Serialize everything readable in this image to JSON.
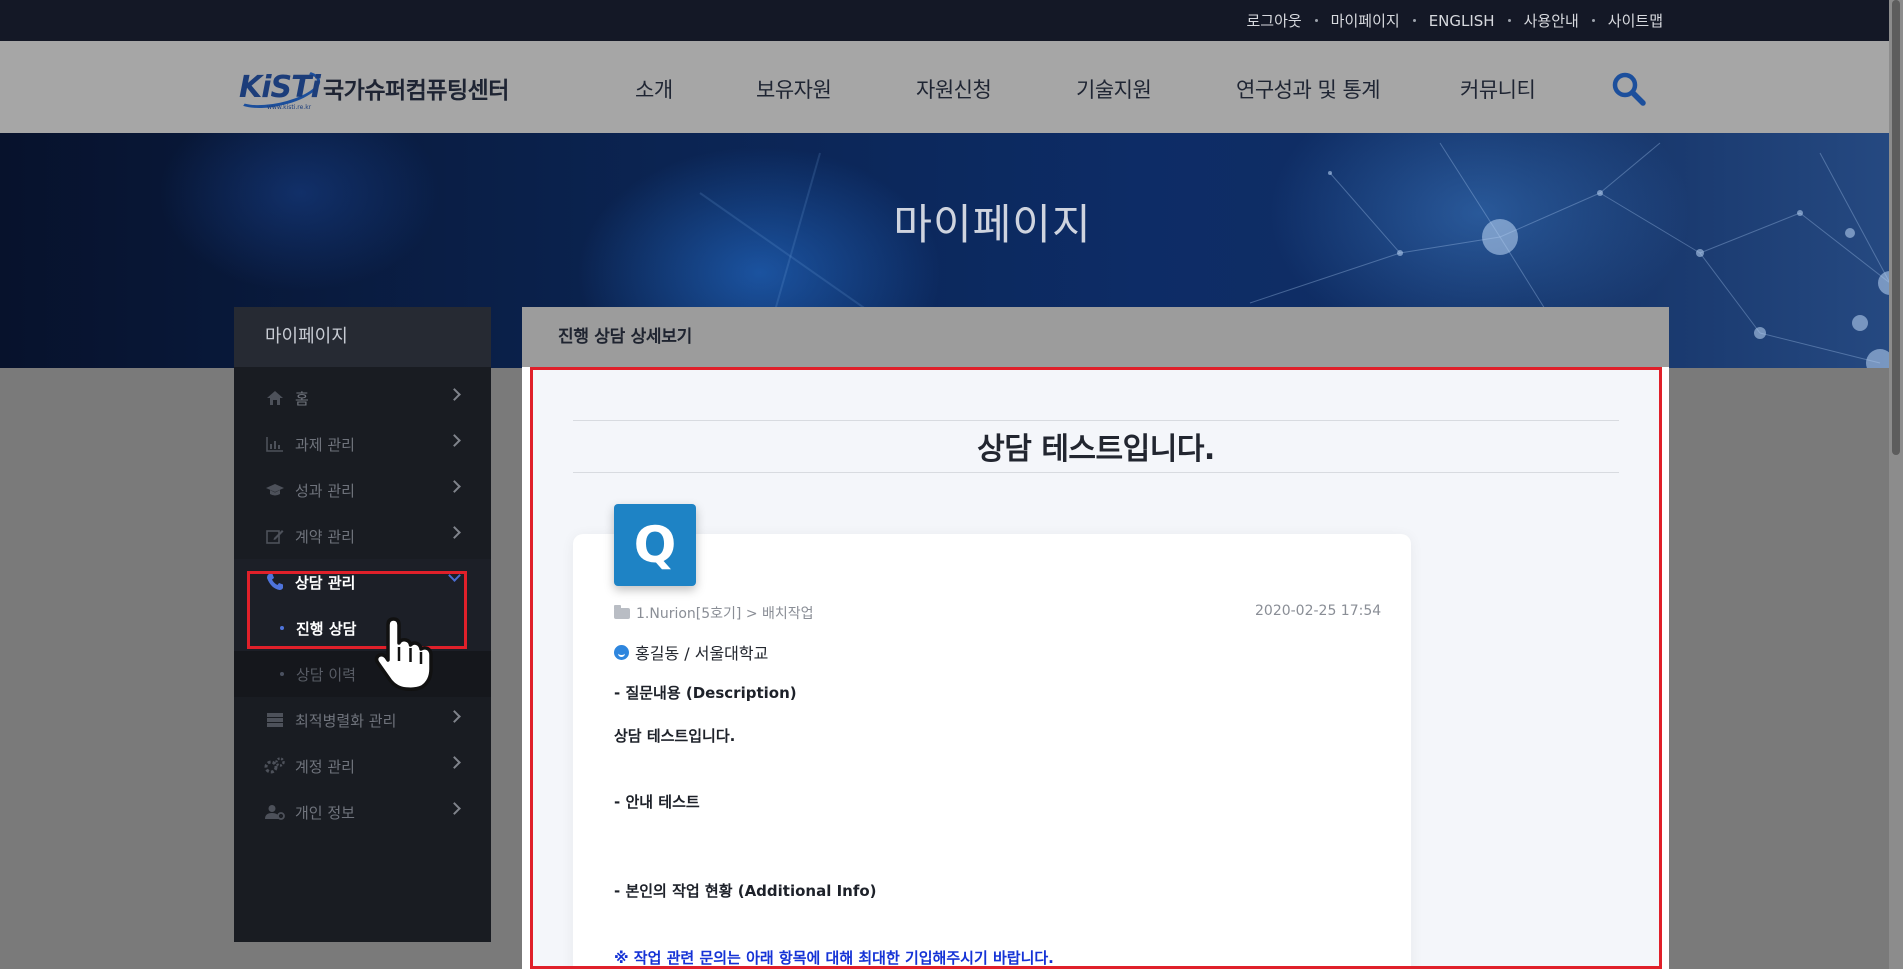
{
  "utility_nav": {
    "logout": "로그아웃",
    "mypage": "마이페이지",
    "english": "ENGLISH",
    "guide": "사용안내",
    "sitemap": "사이트맵"
  },
  "header": {
    "logo_mark": "KiSTi",
    "logo_url": "www.kisti.re.kr",
    "logo_name": "국가슈퍼컴퓨팅센터",
    "menu": [
      "소개",
      "보유자원",
      "자원신청",
      "기술지원",
      "연구성과 및 통계",
      "커뮤니티"
    ],
    "search_icon": "search-icon"
  },
  "banner": {
    "title": "마이페이지"
  },
  "sidebar": {
    "title": "마이페이지",
    "items": [
      {
        "label": "홈",
        "icon": "home-icon"
      },
      {
        "label": "과제 관리",
        "icon": "chart-icon"
      },
      {
        "label": "성과 관리",
        "icon": "graduation-cap-icon"
      },
      {
        "label": "계약 관리",
        "icon": "edit-icon"
      },
      {
        "label": "상담 관리",
        "icon": "phone-icon",
        "active": true
      },
      {
        "label": "최적병렬화 관리",
        "icon": "server-icon"
      },
      {
        "label": "계정 관리",
        "icon": "cogs-icon"
      },
      {
        "label": "개인 정보",
        "icon": "user-icon"
      }
    ],
    "subitems": [
      {
        "label": "진행 상담",
        "selected": true
      },
      {
        "label": "상담 이력"
      }
    ]
  },
  "panel": {
    "title": "진행 상담 상세보기",
    "subject": "상담 테스트입니다.",
    "badge": "Q",
    "category": "1.Nurion[5호기] > 배치작업",
    "datetime": "2020-02-25 17:54",
    "author": "홍길동 / 서울대학교",
    "lines": [
      "- 질문내용 (Description)",
      "상담 테스트입니다.",
      "- 안내 테스트",
      "- 본인의 작업 현황 (Additional Info)",
      "※ 작업 관련 문의는 아래 항목에 대해 최대한 기입해주시기 바랍니다."
    ]
  },
  "colors": {
    "highlight": "#e0202a",
    "accent_blue": "#1e83c5",
    "notice_text": "#1533d6"
  }
}
